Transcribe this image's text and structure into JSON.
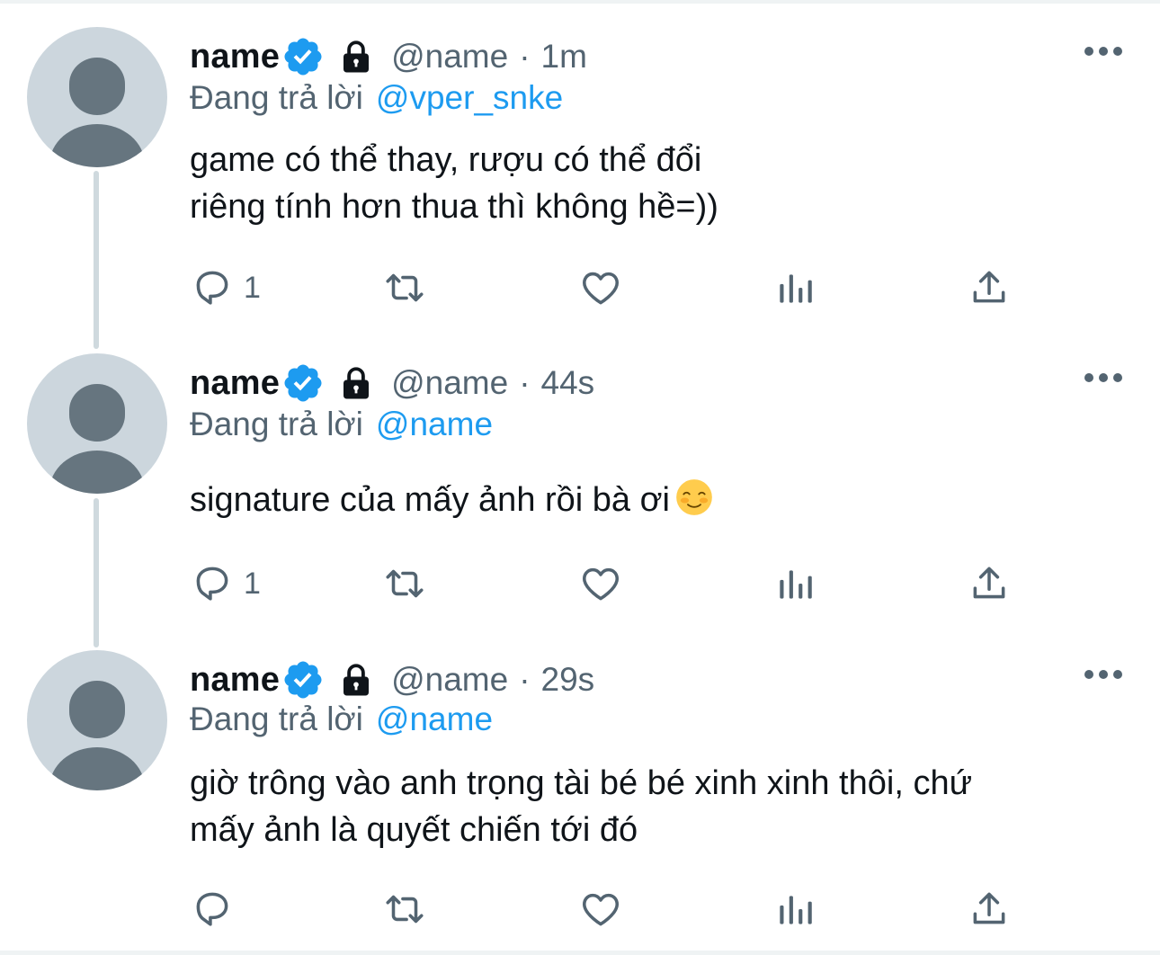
{
  "colors": {
    "text_primary": "#0f1419",
    "text_secondary": "#536471",
    "accent": "#1d9bf0",
    "thread_line": "#cfd9de",
    "avatar_bg": "#ccd6dd",
    "avatar_fg": "#66757f"
  },
  "reply_prefix": "Đang trả lời",
  "tweets": [
    {
      "name": "name",
      "handle": "@name",
      "separator": "·",
      "time": "1m",
      "reply_to": "@vper_snke",
      "lines": [
        "game có thể thay, rượu có thể đổi",
        "riêng tính hơn thua thì không hề=))"
      ],
      "reply_count": "1",
      "icons": [
        "verified-badge-icon",
        "lock-icon",
        "more-icon",
        "reply-icon",
        "retweet-icon",
        "like-icon",
        "analytics-icon",
        "share-icon"
      ]
    },
    {
      "name": "name",
      "handle": "@name",
      "separator": "·",
      "time": "44s",
      "reply_to": "@name",
      "lines": [
        "signature của mấy ảnh rồi bà ơi"
      ],
      "emoji": "smiling-face-emoji",
      "reply_count": "1",
      "icons": [
        "verified-badge-icon",
        "lock-icon",
        "more-icon",
        "reply-icon",
        "retweet-icon",
        "like-icon",
        "analytics-icon",
        "share-icon"
      ]
    },
    {
      "name": "name",
      "handle": "@name",
      "separator": "·",
      "time": "29s",
      "reply_to": "@name",
      "lines": [
        "giờ trông vào anh trọng tài bé bé xinh xinh thôi, chứ",
        "mấy ảnh là quyết chiến tới đó"
      ],
      "reply_count": "",
      "icons": [
        "verified-badge-icon",
        "lock-icon",
        "more-icon",
        "reply-icon",
        "retweet-icon",
        "like-icon",
        "analytics-icon",
        "share-icon"
      ]
    }
  ]
}
